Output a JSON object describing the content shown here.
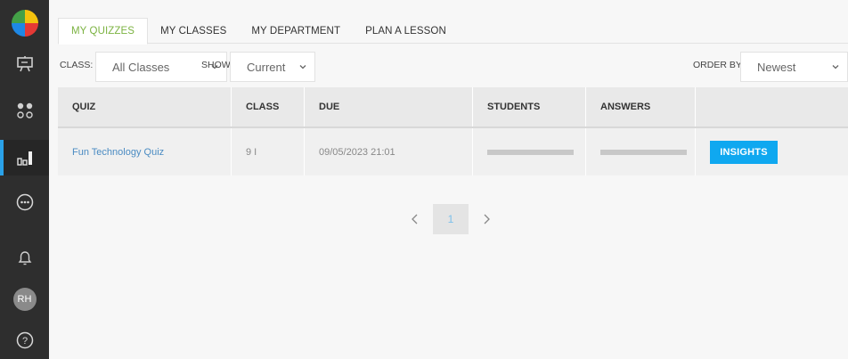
{
  "sidebar": {
    "items": [
      {
        "icon": "presentation-board-icon"
      },
      {
        "icon": "apps-dots-icon"
      },
      {
        "icon": "bar-chart-icon",
        "active": true
      },
      {
        "icon": "more-options-icon"
      },
      {
        "icon": "bell-icon"
      },
      {
        "avatar_initials": "RH"
      },
      {
        "icon": "help-icon"
      }
    ]
  },
  "tabs": [
    "MY QUIZZES",
    "MY CLASSES",
    "MY DEPARTMENT",
    "PLAN A LESSON"
  ],
  "filters": {
    "class_label": "CLASS:",
    "class_value": "All Classes",
    "show_label": "SHOW:",
    "show_value": "Current",
    "order_label": "ORDER BY:",
    "order_value": "Newest"
  },
  "table": {
    "headers": [
      "QUIZ",
      "CLASS",
      "DUE",
      "STUDENTS",
      "ANSWERS"
    ],
    "rows": [
      {
        "quiz": "Fun Technology Quiz",
        "class": "9 I",
        "due": "09/05/2023 21:01",
        "action": "INSIGHTS"
      }
    ]
  },
  "pagination": {
    "current": "1"
  },
  "colors": {
    "accent_green": "#7cb342",
    "accent_blue": "#0fa8f0",
    "sidebar_bg": "#2e2e2e"
  }
}
